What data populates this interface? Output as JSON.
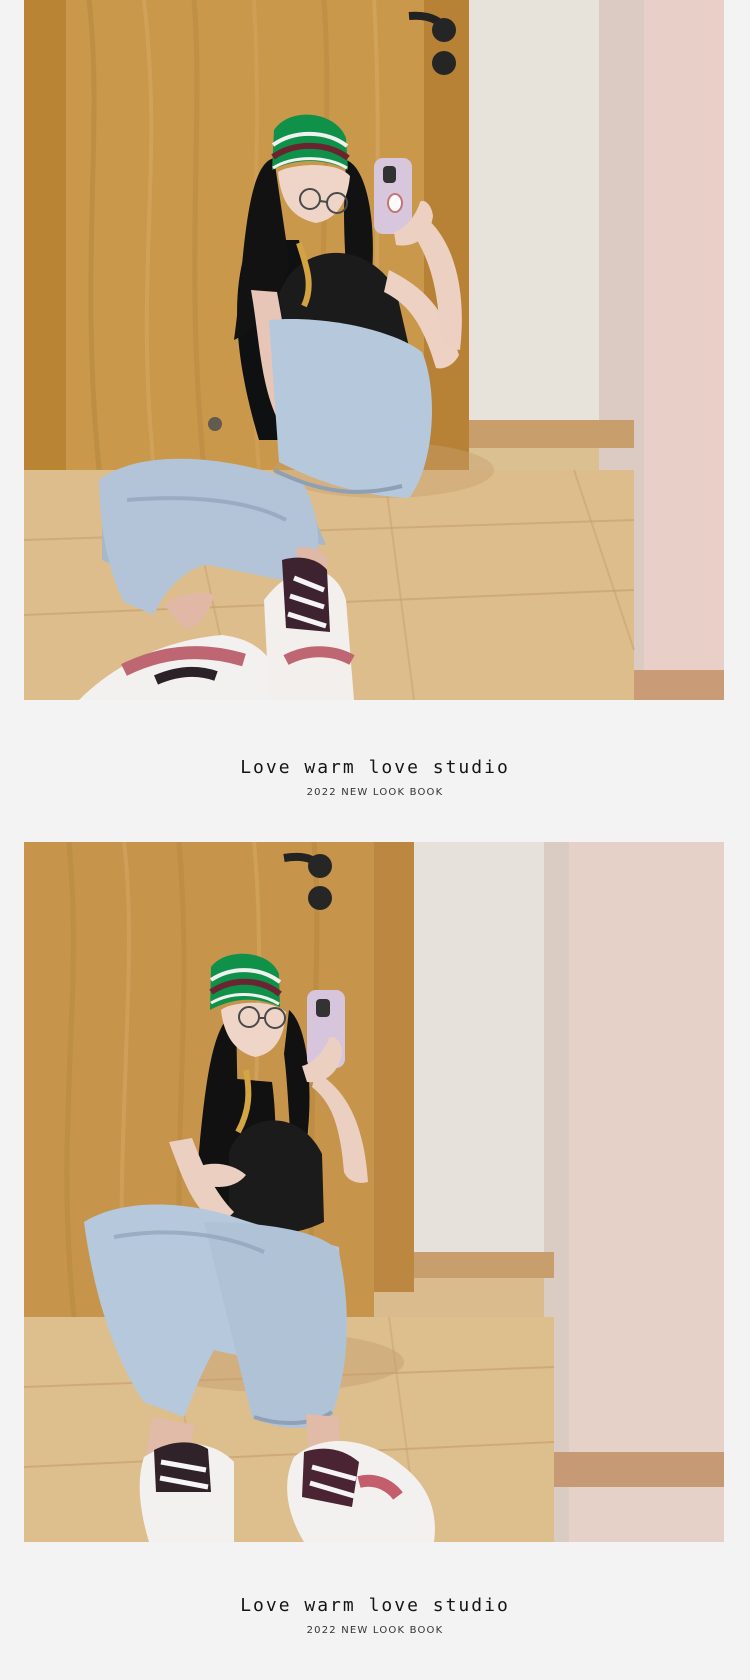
{
  "sections": [
    {
      "caption": {
        "title": "Love warm love studio",
        "subtitle": "2022 NEW LOOK BOOK"
      }
    },
    {
      "caption": {
        "title": "Love warm love studio",
        "subtitle": "2022 NEW LOOK BOOK"
      }
    }
  ]
}
